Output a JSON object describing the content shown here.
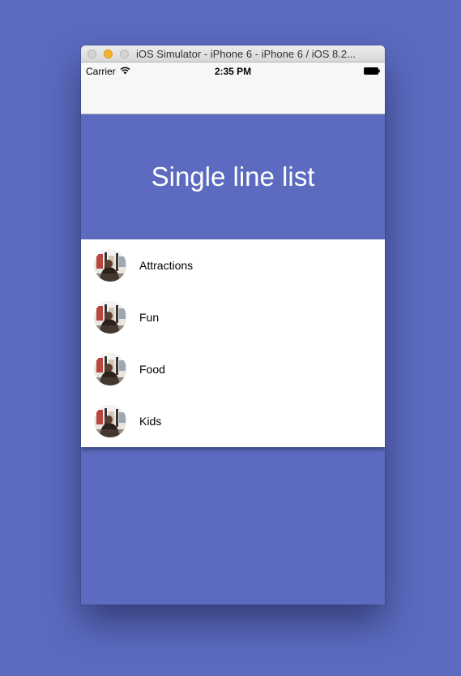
{
  "window": {
    "title": "iOS Simulator - iPhone 6 - iPhone 6 / iOS 8.2..."
  },
  "status_bar": {
    "carrier": "Carrier",
    "time": "2:35 PM"
  },
  "header": {
    "title": "Single line list"
  },
  "list": {
    "items": [
      {
        "label": "Attractions",
        "avatar": "place-photo-avatar"
      },
      {
        "label": "Fun",
        "avatar": "place-photo-avatar"
      },
      {
        "label": "Food",
        "avatar": "place-photo-avatar"
      },
      {
        "label": "Kids",
        "avatar": "place-photo-avatar"
      }
    ]
  },
  "colors": {
    "desktop_background": "#5c6bc0",
    "header_background": "#5c6bc0",
    "list_background": "#ffffff"
  }
}
